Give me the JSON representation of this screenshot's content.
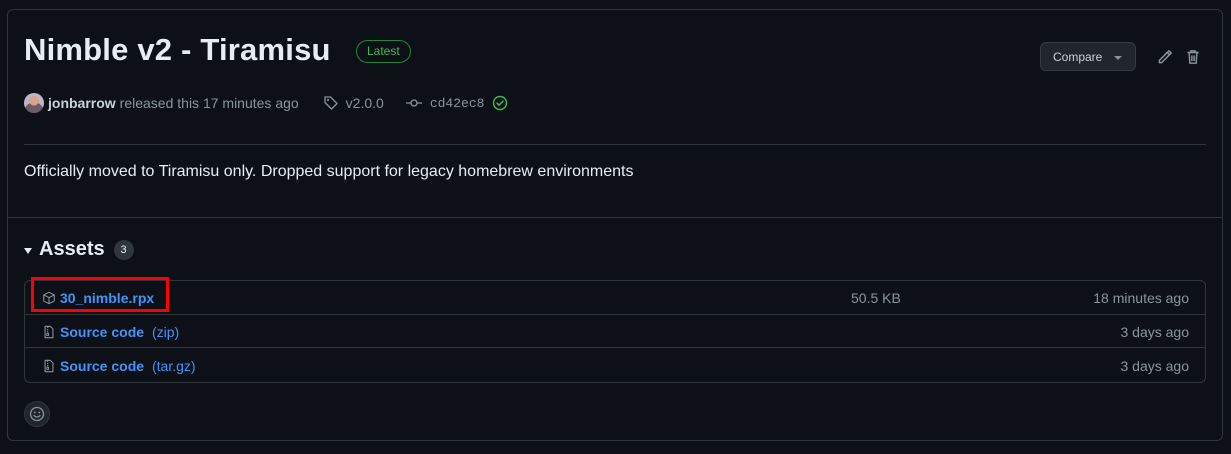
{
  "release": {
    "title": "Nimble v2 - Tiramisu",
    "badge": "Latest",
    "compare_label": "Compare",
    "author": "jonbarrow",
    "released_text": "released this 17 minutes ago",
    "tag": "v2.0.0",
    "commit": "cd42ec8",
    "body": "Officially moved to Tiramisu only. Dropped support for legacy homebrew environments"
  },
  "assets": {
    "title": "Assets",
    "count": "3",
    "items": [
      {
        "name": "30_nimble.rpx",
        "ext": "",
        "size": "50.5 KB",
        "time": "18 minutes ago",
        "icon": "package-icon"
      },
      {
        "name": "Source code",
        "ext": "(zip)",
        "size": "",
        "time": "3 days ago",
        "icon": "file-zip-icon"
      },
      {
        "name": "Source code",
        "ext": "(tar.gz)",
        "size": "",
        "time": "3 days ago",
        "icon": "file-zip-icon"
      }
    ]
  },
  "colors": {
    "background": "#0d1117",
    "border": "#30363d",
    "link": "#4493f8",
    "success": "#3fb950",
    "highlight": "#ff0000"
  }
}
